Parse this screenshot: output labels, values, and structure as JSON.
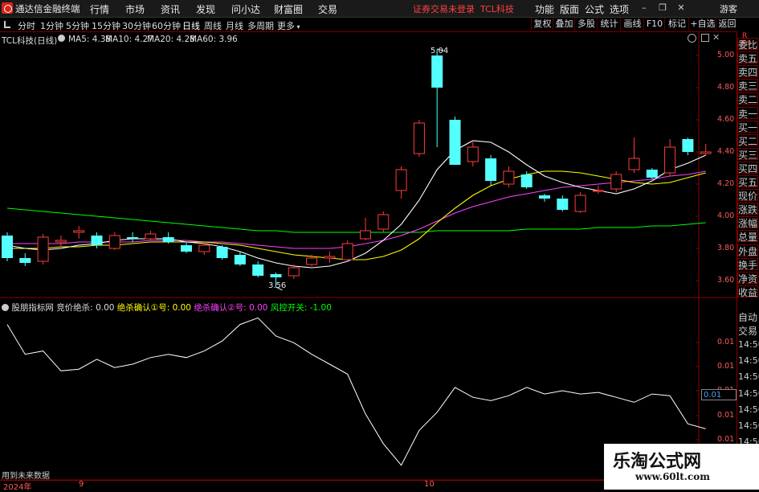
{
  "app": {
    "title": "通达信金融终端",
    "menus": [
      "行情",
      "市场",
      "资讯",
      "发现",
      "问小达",
      "财富圈",
      "交易"
    ],
    "status_warning": "证券交易未登录",
    "stock_name_top": "TCL科技",
    "right_menus": [
      "功能",
      "版面",
      "公式",
      "选项"
    ],
    "guest": "游客"
  },
  "toolbar": {
    "periods": [
      "分时",
      "1分钟",
      "5分钟",
      "15分钟",
      "30分钟",
      "60分钟",
      "日线",
      "周线",
      "月线",
      "多周期",
      "更多"
    ],
    "active_period": "日线",
    "right_buttons": [
      "复权",
      "叠加",
      "多股",
      "统计",
      "画线",
      "F10",
      "标记",
      "+自选",
      "返回"
    ]
  },
  "main_chart": {
    "stock_label": "TCL科技(日线)",
    "ma_labels": [
      {
        "text": "MA5: 4.38",
        "color": "#ffffff"
      },
      {
        "text": "MA10: 4.27",
        "color": "#ffff00"
      },
      {
        "text": "MA20: 4.28",
        "color": "#ff40ff"
      },
      {
        "text": "MA60: 3.96",
        "color": "#00ff00"
      }
    ],
    "price_ticks": [
      "5.00",
      "4.80",
      "4.60",
      "4.40",
      "4.20",
      "4.00",
      "3.80",
      "3.60"
    ],
    "high_label": "5.04",
    "low_label": "3.56"
  },
  "indicator": {
    "title": "股朋指标网",
    "items": [
      {
        "text": "竞价绝杀: 0.00",
        "color": "#dddddd"
      },
      {
        "text": "绝杀确认①号: 0.00",
        "color": "#ffff00"
      },
      {
        "text": "绝杀确认②号: 0.00",
        "color": "#ff40ff"
      },
      {
        "text": "风控开关: -1.00",
        "color": "#00ff00"
      }
    ],
    "ticks": [
      "0.01",
      "0.01",
      "0.01",
      "0.01",
      "0.01"
    ],
    "current_value": "0.01"
  },
  "side_panel": {
    "header_letter": "R",
    "header_num": "300",
    "items": [
      "委比",
      "卖五",
      "卖四",
      "卖三",
      "卖二",
      "卖一",
      "买一",
      "买二",
      "买三",
      "买四",
      "买五",
      "现价",
      "涨跌",
      "涨幅",
      "总量",
      "外盘",
      "换手",
      "净资",
      "收益"
    ],
    "bottom_items": [
      "自动",
      "交易"
    ],
    "times": [
      "14:56",
      "14:56",
      "14:56",
      "14:56",
      "14:56",
      "14:56",
      "14:56"
    ]
  },
  "bottom_axis": {
    "future_label": "用到未来数据",
    "year_label": "2024年",
    "month_labels": [
      "9",
      "10"
    ]
  },
  "watermark": {
    "title": "乐淘公式网",
    "url": "www.60lt.com"
  },
  "colors": {
    "up": "#ff3b3b",
    "down": "#54ffff",
    "grid": "#8a0000",
    "tick": "#ff5a5a"
  },
  "chart_data": {
    "type": "candlestick",
    "title": "TCL科技(日线)",
    "candles": [
      {
        "o": 3.88,
        "c": 3.74,
        "h": 3.9,
        "l": 3.72
      },
      {
        "o": 3.74,
        "c": 3.71,
        "h": 3.77,
        "l": 3.69
      },
      {
        "o": 3.72,
        "c": 3.87,
        "h": 3.89,
        "l": 3.7
      },
      {
        "o": 3.84,
        "c": 3.85,
        "h": 3.88,
        "l": 3.81
      },
      {
        "o": 3.9,
        "c": 3.91,
        "h": 3.94,
        "l": 3.86
      },
      {
        "o": 3.88,
        "c": 3.82,
        "h": 3.9,
        "l": 3.8
      },
      {
        "o": 3.8,
        "c": 3.88,
        "h": 3.9,
        "l": 3.79
      },
      {
        "o": 3.87,
        "c": 3.86,
        "h": 3.9,
        "l": 3.84
      },
      {
        "o": 3.86,
        "c": 3.89,
        "h": 3.91,
        "l": 3.85
      },
      {
        "o": 3.87,
        "c": 3.84,
        "h": 3.9,
        "l": 3.83
      },
      {
        "o": 3.82,
        "c": 3.78,
        "h": 3.84,
        "l": 3.77
      },
      {
        "o": 3.78,
        "c": 3.82,
        "h": 3.84,
        "l": 3.76
      },
      {
        "o": 3.81,
        "c": 3.74,
        "h": 3.82,
        "l": 3.73
      },
      {
        "o": 3.76,
        "c": 3.7,
        "h": 3.78,
        "l": 3.69
      },
      {
        "o": 3.7,
        "c": 3.63,
        "h": 3.72,
        "l": 3.62
      },
      {
        "o": 3.64,
        "c": 3.62,
        "h": 3.65,
        "l": 3.56
      },
      {
        "o": 3.63,
        "c": 3.68,
        "h": 3.7,
        "l": 3.61
      },
      {
        "o": 3.7,
        "c": 3.74,
        "h": 3.76,
        "l": 3.69
      },
      {
        "o": 3.74,
        "c": 3.75,
        "h": 3.78,
        "l": 3.71
      },
      {
        "o": 3.73,
        "c": 3.83,
        "h": 3.85,
        "l": 3.72
      },
      {
        "o": 3.86,
        "c": 3.91,
        "h": 3.99,
        "l": 3.85
      },
      {
        "o": 3.92,
        "c": 4.01,
        "h": 4.03,
        "l": 3.9
      },
      {
        "o": 4.16,
        "c": 4.29,
        "h": 4.31,
        "l": 4.11
      },
      {
        "o": 4.39,
        "c": 4.58,
        "h": 4.6,
        "l": 4.37
      },
      {
        "o": 5.0,
        "c": 4.8,
        "h": 5.04,
        "l": 4.43
      },
      {
        "o": 4.6,
        "c": 4.32,
        "h": 4.62,
        "l": 4.32
      },
      {
        "o": 4.34,
        "c": 4.43,
        "h": 4.47,
        "l": 4.31
      },
      {
        "o": 4.36,
        "c": 4.22,
        "h": 4.38,
        "l": 4.19
      },
      {
        "o": 4.2,
        "c": 4.28,
        "h": 4.31,
        "l": 4.18
      },
      {
        "o": 4.26,
        "c": 4.18,
        "h": 4.28,
        "l": 4.17
      },
      {
        "o": 4.13,
        "c": 4.11,
        "h": 4.14,
        "l": 4.09
      },
      {
        "o": 4.11,
        "c": 4.04,
        "h": 4.13,
        "l": 4.03
      },
      {
        "o": 4.03,
        "c": 4.13,
        "h": 4.15,
        "l": 4.02
      },
      {
        "o": 4.16,
        "c": 4.16,
        "h": 4.19,
        "l": 4.14
      },
      {
        "o": 4.17,
        "c": 4.26,
        "h": 4.28,
        "l": 4.15
      },
      {
        "o": 4.29,
        "c": 4.36,
        "h": 4.49,
        "l": 4.27
      },
      {
        "o": 4.29,
        "c": 4.24,
        "h": 4.3,
        "l": 4.23
      },
      {
        "o": 4.27,
        "c": 4.43,
        "h": 4.48,
        "l": 4.25
      },
      {
        "o": 4.48,
        "c": 4.4,
        "h": 4.49,
        "l": 4.38
      },
      {
        "o": 4.39,
        "c": 4.4,
        "h": 4.45,
        "l": 4.38
      }
    ],
    "ma5": [
      3.82,
      3.8,
      3.79,
      3.8,
      3.82,
      3.83,
      3.85,
      3.86,
      3.86,
      3.86,
      3.84,
      3.83,
      3.81,
      3.78,
      3.74,
      3.71,
      3.69,
      3.68,
      3.69,
      3.72,
      3.77,
      3.85,
      3.95,
      4.1,
      4.29,
      4.41,
      4.47,
      4.46,
      4.4,
      4.32,
      4.25,
      4.21,
      4.18,
      4.16,
      4.14,
      4.17,
      4.22,
      4.29,
      4.33,
      4.38
    ],
    "ma10": [
      3.8,
      3.8,
      3.8,
      3.81,
      3.81,
      3.82,
      3.82,
      3.83,
      3.84,
      3.84,
      3.84,
      3.84,
      3.83,
      3.82,
      3.8,
      3.78,
      3.76,
      3.75,
      3.74,
      3.73,
      3.73,
      3.75,
      3.79,
      3.86,
      3.96,
      4.05,
      4.13,
      4.19,
      4.23,
      4.26,
      4.28,
      4.28,
      4.27,
      4.25,
      4.23,
      4.21,
      4.2,
      4.21,
      4.24,
      4.27
    ],
    "ma20": [
      3.83,
      3.83,
      3.83,
      3.83,
      3.84,
      3.84,
      3.84,
      3.84,
      3.85,
      3.85,
      3.85,
      3.84,
      3.84,
      3.83,
      3.82,
      3.81,
      3.8,
      3.8,
      3.8,
      3.81,
      3.83,
      3.85,
      3.88,
      3.92,
      3.97,
      4.02,
      4.06,
      4.09,
      4.12,
      4.14,
      4.16,
      4.18,
      4.19,
      4.2,
      4.21,
      4.22,
      4.23,
      4.25,
      4.26,
      4.28
    ],
    "ma60": [
      4.05,
      4.04,
      4.03,
      4.02,
      4.01,
      4.0,
      3.99,
      3.98,
      3.97,
      3.96,
      3.95,
      3.94,
      3.93,
      3.92,
      3.91,
      3.91,
      3.9,
      3.9,
      3.9,
      3.9,
      3.9,
      3.9,
      3.9,
      3.9,
      3.91,
      3.91,
      3.91,
      3.91,
      3.91,
      3.92,
      3.92,
      3.92,
      3.92,
      3.93,
      3.93,
      3.93,
      3.94,
      3.94,
      3.95,
      3.96
    ],
    "indicator_line": [
      0.9,
      0.72,
      0.74,
      0.62,
      0.63,
      0.69,
      0.64,
      0.66,
      0.7,
      0.72,
      0.7,
      0.74,
      0.8,
      0.9,
      0.94,
      0.83,
      0.79,
      0.72,
      0.66,
      0.6,
      0.36,
      0.18,
      0.05,
      0.26,
      0.37,
      0.52,
      0.46,
      0.44,
      0.47,
      0.52,
      0.48,
      0.5,
      0.48,
      0.49,
      0.46,
      0.43,
      0.48,
      0.47,
      0.3,
      0.27
    ],
    "ylim": [
      3.5,
      5.1
    ]
  }
}
